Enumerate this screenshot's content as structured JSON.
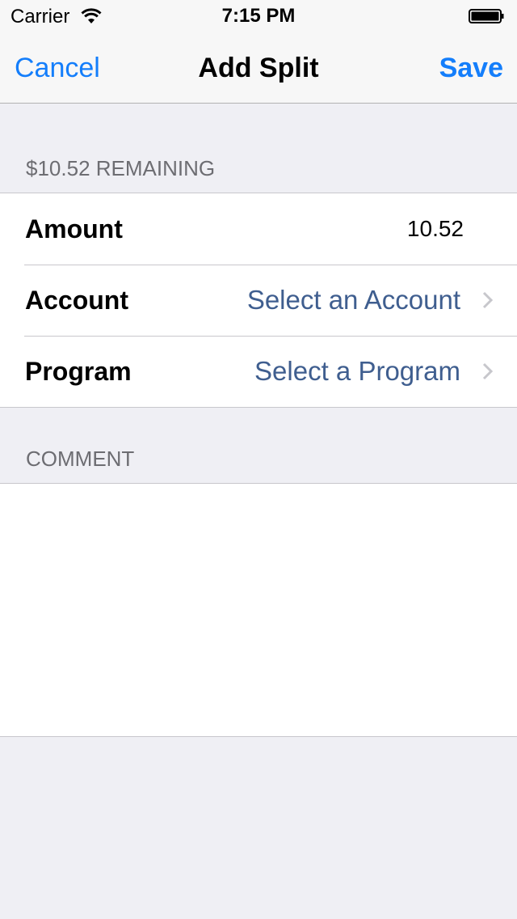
{
  "status_bar": {
    "carrier": "Carrier",
    "time": "7:15 PM",
    "icons": [
      "wifi-icon",
      "battery-icon"
    ]
  },
  "nav": {
    "cancel_label": "Cancel",
    "title": "Add Split",
    "save_label": "Save"
  },
  "split_section": {
    "header": "$10.52 REMAINING",
    "rows": [
      {
        "label": "Amount",
        "value": "10.52"
      },
      {
        "label": "Account",
        "value": "Select an Account",
        "icon": "chevron-right-icon"
      },
      {
        "label": "Program",
        "value": "Select a Program",
        "icon": "chevron-right-icon"
      }
    ]
  },
  "comment_section": {
    "header": "COMMENT",
    "value": ""
  },
  "colors": {
    "tint": "#147efb",
    "detail_text": "#3f5e8f",
    "section_header": "#6d6d72",
    "background": "#efeff4",
    "separator": "#c8c7cc"
  }
}
